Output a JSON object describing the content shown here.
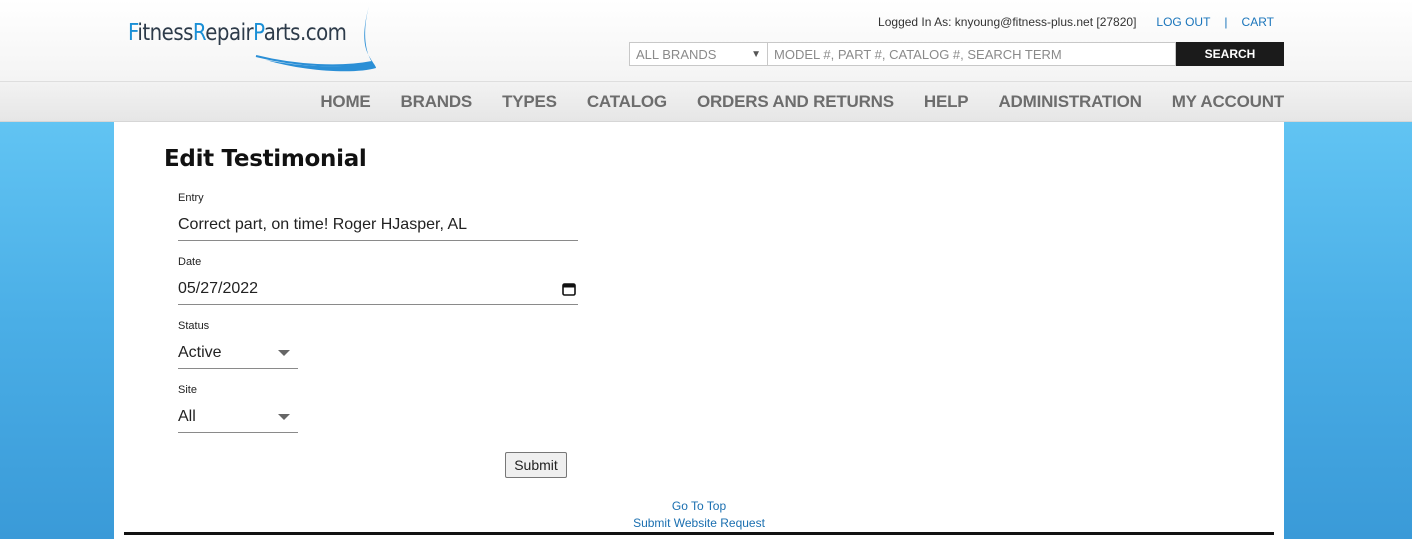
{
  "header": {
    "logo": {
      "part1_cap": "F",
      "part1_rest": "itness",
      "part2_cap": "R",
      "part2_rest": "epair",
      "part3_cap": "P",
      "part3_rest": "arts.com"
    },
    "logged_in_text": "Logged In As: knyoung@fitness-plus.net [27820]",
    "logout_label": "LOG OUT",
    "separator": "|",
    "cart_label": "CART",
    "brand_select_value": "ALL BRANDS",
    "search_placeholder": "MODEL #, PART #, CATALOG #, SEARCH TERM",
    "search_button": "SEARCH"
  },
  "nav": {
    "items": [
      {
        "label": "HOME"
      },
      {
        "label": "BRANDS"
      },
      {
        "label": "TYPES"
      },
      {
        "label": "CATALOG"
      },
      {
        "label": "ORDERS AND RETURNS"
      },
      {
        "label": "HELP"
      },
      {
        "label": "ADMINISTRATION"
      },
      {
        "label": "MY ACCOUNT"
      }
    ]
  },
  "form": {
    "title": "Edit Testimonial",
    "entry": {
      "label": "Entry",
      "value": "Correct part, on time! Roger HJasper, AL"
    },
    "date": {
      "label": "Date",
      "value": "05/27/2022"
    },
    "status": {
      "label": "Status",
      "value": "Active"
    },
    "site": {
      "label": "Site",
      "value": "All"
    },
    "submit_label": "Submit"
  },
  "footer": {
    "go_to_top": "Go To Top",
    "submit_request": "Submit Website Request"
  },
  "colors": {
    "accent": "#1a75bb",
    "background_top": "#6fd1fb",
    "background_bottom": "#3a9ad8",
    "search_button": "#1b1b1b"
  }
}
